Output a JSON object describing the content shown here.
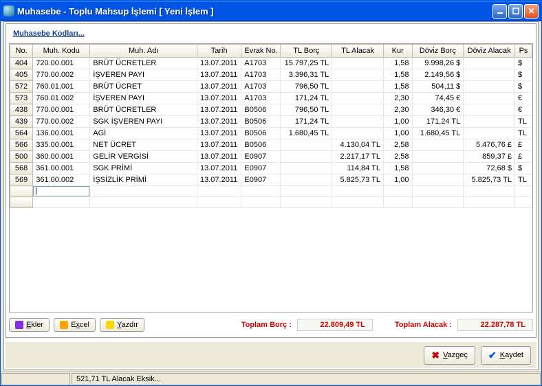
{
  "window": {
    "title": "Muhasebe - Toplu Mahsup İşlemi [ Yeni İşlem ]"
  },
  "linklabel": "Muhasebe Kodları...",
  "columns": [
    "No.",
    "Muh. Kodu",
    "Muh. Adı",
    "Tarih",
    "Evrak No.",
    "TL Borç",
    "TL Alacak",
    "Kur",
    "Döviz Borç",
    "Döviz Alacak",
    "Ps"
  ],
  "rows": [
    {
      "no": "404",
      "kodu": "720.00.001",
      "adi": "BRÜT ÜCRETLER",
      "tarih": "13.07.2011",
      "evrak": "A1703",
      "borc": "15.797,25 TL",
      "alacak": "",
      "kur": "1,58",
      "dborc": "9.998,26 $",
      "dalacak": "",
      "ps": "$"
    },
    {
      "no": "405",
      "kodu": "770.00.002",
      "adi": "İŞVEREN PAYI",
      "tarih": "13.07.2011",
      "evrak": "A1703",
      "borc": "3.396,31 TL",
      "alacak": "",
      "kur": "1,58",
      "dborc": "2.149,56 $",
      "dalacak": "",
      "ps": "$"
    },
    {
      "no": "572",
      "kodu": "760.01.001",
      "adi": "BRÜT ÜCRET",
      "tarih": "13.07.2011",
      "evrak": "A1703",
      "borc": "796,50 TL",
      "alacak": "",
      "kur": "1,58",
      "dborc": "504,11 $",
      "dalacak": "",
      "ps": "$"
    },
    {
      "no": "573",
      "kodu": "760.01.002",
      "adi": "İŞVEREN PAYI",
      "tarih": "13.07.2011",
      "evrak": "A1703",
      "borc": "171,24 TL",
      "alacak": "",
      "kur": "2,30",
      "dborc": "74,45 €",
      "dalacak": "",
      "ps": "€"
    },
    {
      "no": "438",
      "kodu": "770.00.001",
      "adi": "BRÜT ÜCRETLER",
      "tarih": "13.07.2011",
      "evrak": "B0506",
      "borc": "796,50 TL",
      "alacak": "",
      "kur": "2,30",
      "dborc": "346,30 €",
      "dalacak": "",
      "ps": "€"
    },
    {
      "no": "439",
      "kodu": "770.00.002",
      "adi": "SGK İŞVEREN PAYI",
      "tarih": "13.07.2011",
      "evrak": "B0506",
      "borc": "171,24 TL",
      "alacak": "",
      "kur": "1,00",
      "dborc": "171,24 TL",
      "dalacak": "",
      "ps": "TL"
    },
    {
      "no": "564",
      "kodu": "136.00.001",
      "adi": "AGİ",
      "tarih": "13.07.2011",
      "evrak": "B0506",
      "borc": "1.680,45 TL",
      "alacak": "",
      "kur": "1,00",
      "dborc": "1.680,45 TL",
      "dalacak": "",
      "ps": "TL"
    },
    {
      "no": "566",
      "kodu": "335.00.001",
      "adi": "NET ÜCRET",
      "tarih": "13.07.2011",
      "evrak": "B0506",
      "borc": "",
      "alacak": "4.130,04 TL",
      "kur": "2,58",
      "dborc": "",
      "dalacak": "5.476,76 £",
      "ps": "£"
    },
    {
      "no": "500",
      "kodu": "360.00.001",
      "adi": "GELİR VERGİSİ",
      "tarih": "13.07.2011",
      "evrak": "E0907",
      "borc": "",
      "alacak": "2.217,17 TL",
      "kur": "2,58",
      "dborc": "",
      "dalacak": "859,37 £",
      "ps": "£"
    },
    {
      "no": "568",
      "kodu": "361.00.001",
      "adi": "SGK PRİMİ",
      "tarih": "13.07.2011",
      "evrak": "E0907",
      "borc": "",
      "alacak": "114,84 TL",
      "kur": "1,58",
      "dborc": "",
      "dalacak": "72,68 $",
      "ps": "$"
    },
    {
      "no": "569",
      "kodu": "361.00.002",
      "adi": "İŞSİZLİK PRİMİ",
      "tarih": "13.07.2011",
      "evrak": "E0907",
      "borc": "",
      "alacak": "5.825,73 TL",
      "kur": "1,00",
      "dborc": "",
      "dalacak": "5.825,73 TL",
      "ps": "TL"
    }
  ],
  "buttons": {
    "ekler": "Ekler",
    "excel": "Excel",
    "yazdir": "Yazdır",
    "vazgec": "Vazgeç",
    "kaydet": "Kaydet"
  },
  "totals": {
    "borc_label": "Toplam Borç :",
    "borc_val": "22.809,49 TL",
    "alacak_label": "Toplam Alacak :",
    "alacak_val": "22.287,78 TL"
  },
  "status": "521,71 TL Alacak Eksik..."
}
